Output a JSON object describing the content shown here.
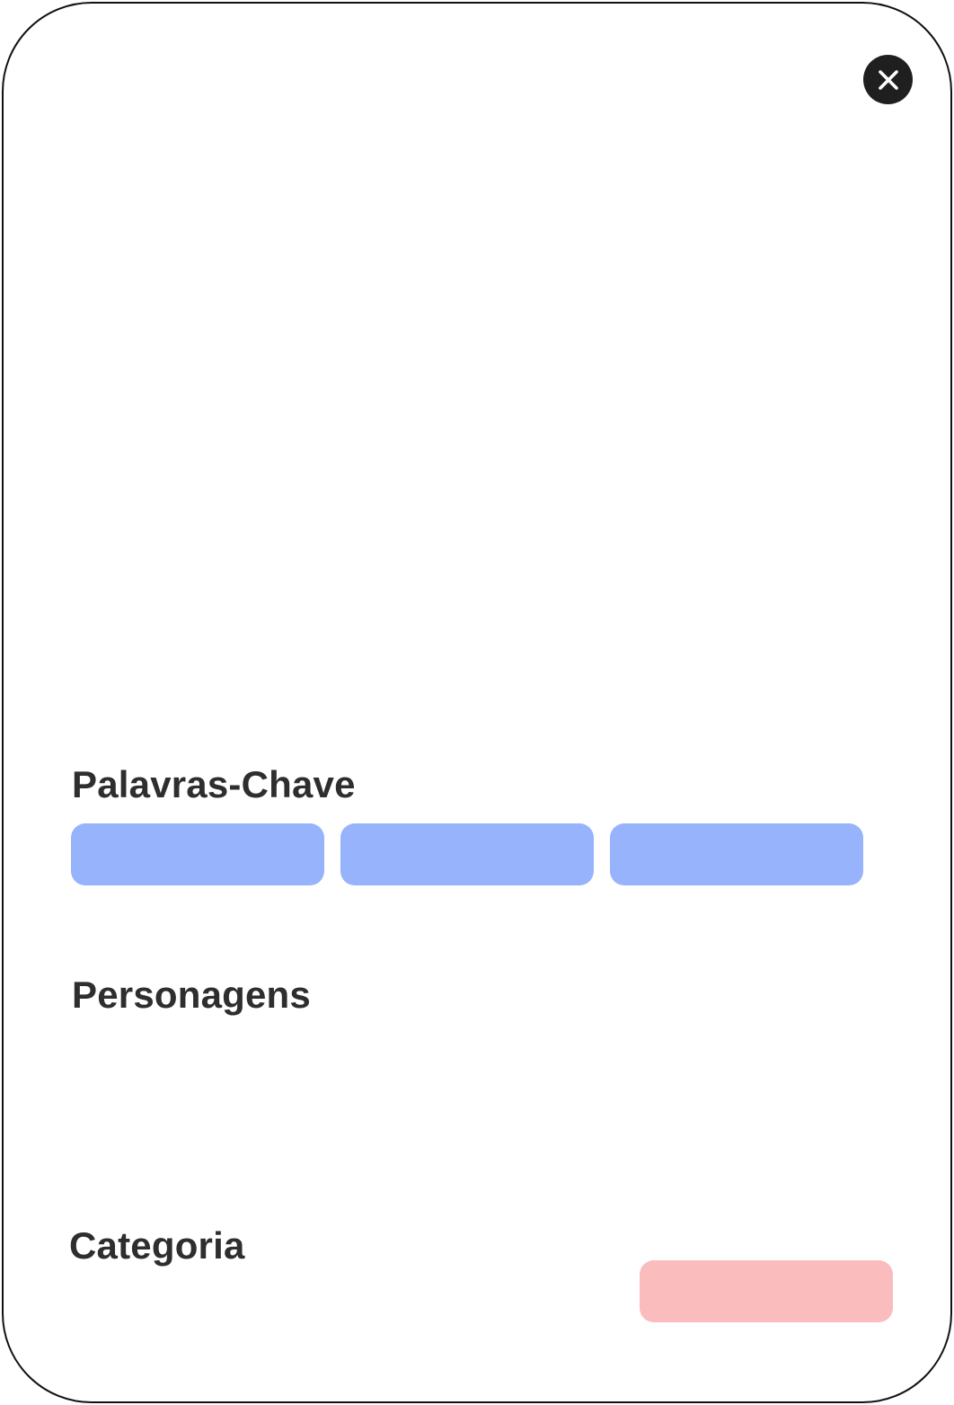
{
  "close_icon": "close-icon",
  "sections": {
    "keywords": {
      "title": "Palavras-Chave",
      "chip_color": "#97b3fc",
      "chips": [
        "",
        "",
        ""
      ]
    },
    "characters": {
      "title": "Personagens"
    },
    "category": {
      "title": "Categoria",
      "chip_color": "#fabcbd",
      "chips": [
        ""
      ]
    }
  },
  "colors": {
    "border": "#111111",
    "close_button_bg": "#1f1f1f",
    "title_text": "#2e2e2e",
    "background": "#ffffff"
  }
}
